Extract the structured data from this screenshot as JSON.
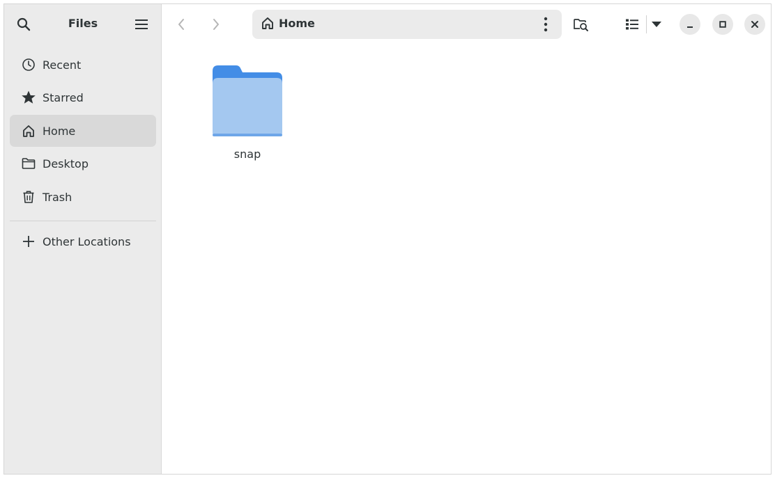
{
  "sidebar": {
    "title": "Files",
    "items": [
      {
        "label": "Recent",
        "icon": "clock-icon"
      },
      {
        "label": "Starred",
        "icon": "star-icon"
      },
      {
        "label": "Home",
        "icon": "home-icon"
      },
      {
        "label": "Desktop",
        "icon": "folder-icon"
      },
      {
        "label": "Trash",
        "icon": "trash-icon"
      },
      {
        "label": "Other Locations",
        "icon": "plus-icon"
      }
    ],
    "active_item": "Home"
  },
  "pathbar": {
    "location": "Home"
  },
  "files": [
    {
      "name": "snap",
      "type": "folder"
    }
  ],
  "colors": {
    "sidebar_bg": "#ebebeb",
    "active_item_bg": "#d9d9d9",
    "folder_front": "#a4c8f0",
    "folder_back": "#438de6",
    "text": "#2e3436"
  }
}
